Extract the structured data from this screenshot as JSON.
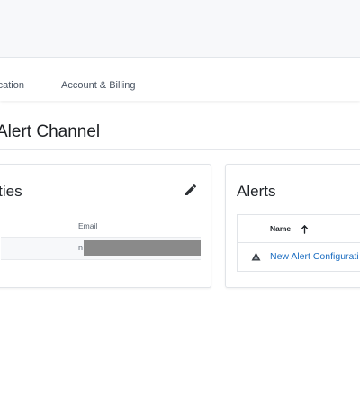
{
  "tabs": [
    {
      "label": "ntication"
    },
    {
      "label": "Account & Billing"
    }
  ],
  "page": {
    "title": "Alert Channel"
  },
  "properties_card": {
    "title": "erties",
    "email_label": "Email",
    "email_value_visible": "n"
  },
  "alerts_card": {
    "title": "Alerts",
    "table": {
      "header_name": "Name",
      "rows": [
        {
          "name": "New Alert Configurati"
        }
      ]
    }
  }
}
